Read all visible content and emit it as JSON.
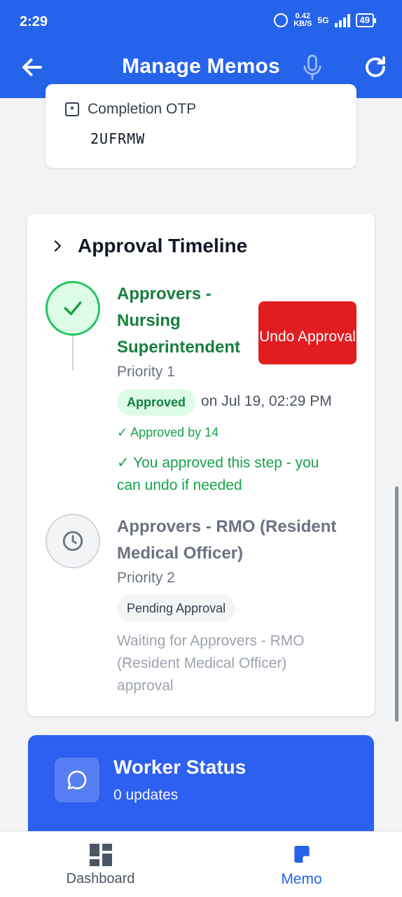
{
  "status_bar": {
    "time": "2:29",
    "net_speed_top": "0.42",
    "net_speed_unit": "KB/S",
    "network": "5G",
    "battery": "49"
  },
  "app_bar": {
    "title": "Manage Memos"
  },
  "otp_card": {
    "label": "Completion OTP",
    "value": "2UFRMW"
  },
  "approval_timeline": {
    "title": "Approval Timeline",
    "steps": [
      {
        "title": "Approvers - Nursing Superintendent",
        "priority": "Priority 1",
        "status_badge": "Approved",
        "approved_on": "on Jul 19, 02:29 PM",
        "approved_by": "✓ Approved by 14",
        "note": "✓ You approved this step - you can undo if needed",
        "action_label": "Undo Approval",
        "state": "approved"
      },
      {
        "title": "Approvers - RMO (Resident Medical Officer)",
        "priority": "Priority 2",
        "status_badge": "Pending Approval",
        "note": "Waiting for Approvers - RMO (Resident Medical Officer) approval",
        "state": "pending"
      }
    ]
  },
  "worker_status": {
    "title": "Worker Status",
    "subtitle": "0 updates"
  },
  "bottom_nav": {
    "items": [
      {
        "label": "Dashboard",
        "icon": "dashboard-icon",
        "active": false
      },
      {
        "label": "Memo",
        "icon": "memo-icon",
        "active": true
      }
    ]
  },
  "colors": {
    "primary": "#2563eb",
    "success": "#16a34a",
    "danger": "#e11d22"
  }
}
